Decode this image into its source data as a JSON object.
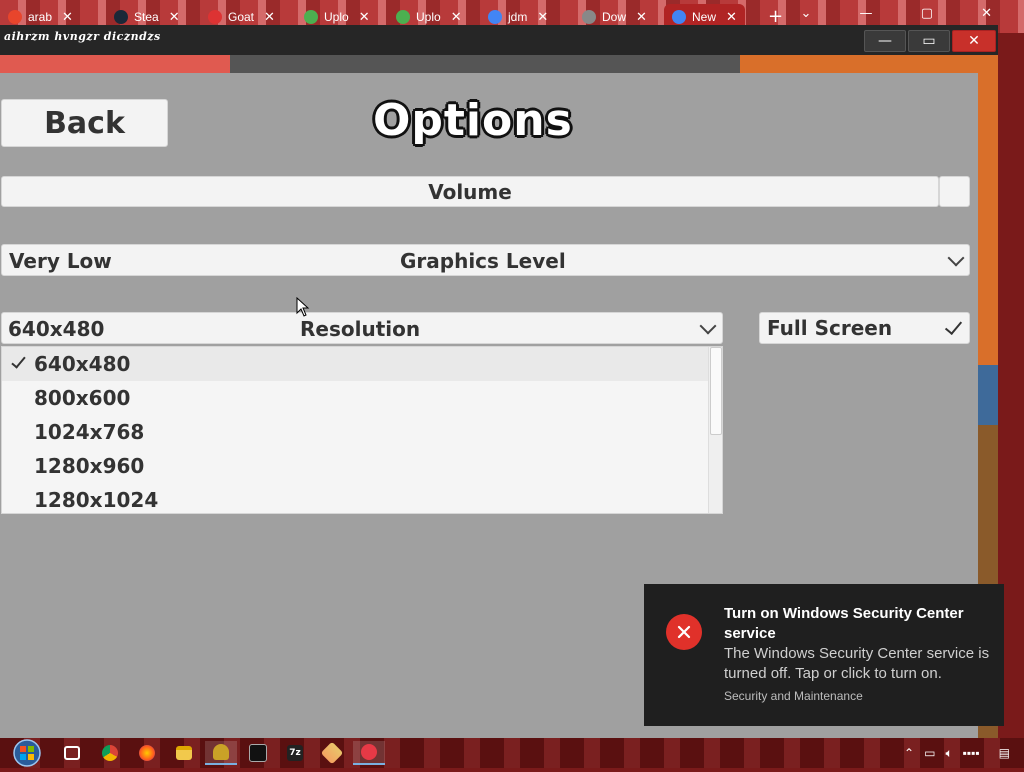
{
  "browser_tabs": [
    {
      "label": "arab",
      "color": "#e8452c"
    },
    {
      "label": "Stea",
      "color": "#1b2838"
    },
    {
      "label": "Goat",
      "color": "#d33"
    },
    {
      "label": "Uplo",
      "color": "#4caf50"
    },
    {
      "label": "Uplo",
      "color": "#4caf50"
    },
    {
      "label": "jdm",
      "color": "#4285f4"
    },
    {
      "label": "Dow",
      "color": "#888"
    },
    {
      "label": "New",
      "color": "#4285f4"
    }
  ],
  "window": {
    "title": "aihrzm hvngzr diczndzs",
    "minimize_icon": "—",
    "maximize_icon": "▭",
    "close_icon": "✕"
  },
  "game": {
    "back_label": "Back",
    "title": "Options",
    "volume_label": "Volume",
    "graphics": {
      "value": "Very Low",
      "label": "Graphics Level"
    },
    "resolution": {
      "value": "640x480",
      "label": "Resolution",
      "options": [
        "640x480",
        "800x600",
        "1024x768",
        "1280x960",
        "1280x1024"
      ],
      "selected_index": 0
    },
    "fullscreen": {
      "label": "Full Screen",
      "checked": true
    }
  },
  "toast": {
    "title": "Turn on Windows Security Center service",
    "body": "The Windows Security Center service is turned off. Tap or click to turn on.",
    "source": "Security and Maintenance"
  },
  "taskbar": {
    "apps": [
      "task-view",
      "chrome",
      "firefox",
      "file-explorer",
      "game",
      "cmd",
      "7zip",
      "app",
      "app2"
    ]
  }
}
